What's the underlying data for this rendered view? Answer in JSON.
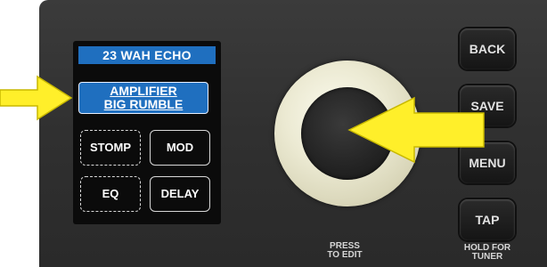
{
  "display": {
    "preset_name": "23 WAH ECHO",
    "amplifier": {
      "line1": "AMPLIFIER",
      "line2": "BIG RUMBLE"
    },
    "effects": {
      "stomp": "STOMP",
      "mod": "MOD",
      "eq": "EQ",
      "delay": "DELAY"
    }
  },
  "buttons": {
    "back": "BACK",
    "save": "SAVE",
    "menu": "MENU",
    "tap": "TAP"
  },
  "captions": {
    "knob_line1": "PRESS",
    "knob_line2": "TO EDIT",
    "tap_line1": "HOLD FOR",
    "tap_line2": "TUNER"
  },
  "colors": {
    "arrow": "#ffef2a",
    "display_accent": "#1f6fbf",
    "panel": "#333333"
  },
  "icons": {
    "left_arrow": "arrow-right-icon",
    "knob_arrow": "arrow-left-icon"
  }
}
